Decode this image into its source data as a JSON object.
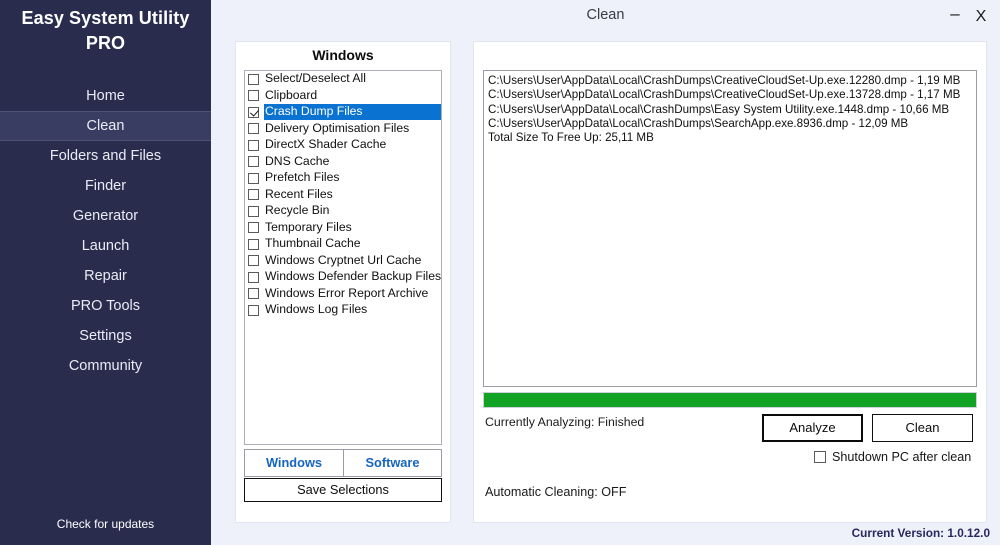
{
  "app": {
    "title": "Easy System Utility PRO",
    "version_label": "Current Version: 1.0.12.0",
    "check_updates": "Check for updates"
  },
  "titlebar": {
    "window_title": "Clean",
    "minimize": "–",
    "close": "X"
  },
  "sidebar": {
    "items": [
      {
        "label": "Home",
        "active": false
      },
      {
        "label": "Clean",
        "active": true
      },
      {
        "label": "Folders and Files",
        "active": false
      },
      {
        "label": "Finder",
        "active": false
      },
      {
        "label": "Generator",
        "active": false
      },
      {
        "label": "Launch",
        "active": false
      },
      {
        "label": "Repair",
        "active": false
      },
      {
        "label": "PRO Tools",
        "active": false
      },
      {
        "label": "Settings",
        "active": false
      },
      {
        "label": "Community",
        "active": false
      }
    ]
  },
  "left_panel": {
    "header": "Windows",
    "checkboxes": [
      {
        "label": "Select/Deselect All",
        "checked": false,
        "selected": false
      },
      {
        "label": "Clipboard",
        "checked": false,
        "selected": false
      },
      {
        "label": "Crash Dump Files",
        "checked": true,
        "selected": true
      },
      {
        "label": "Delivery Optimisation Files",
        "checked": false,
        "selected": false
      },
      {
        "label": "DirectX Shader Cache",
        "checked": false,
        "selected": false
      },
      {
        "label": "DNS Cache",
        "checked": false,
        "selected": false
      },
      {
        "label": "Prefetch Files",
        "checked": false,
        "selected": false
      },
      {
        "label": "Recent Files",
        "checked": false,
        "selected": false
      },
      {
        "label": "Recycle Bin",
        "checked": false,
        "selected": false
      },
      {
        "label": "Temporary Files",
        "checked": false,
        "selected": false
      },
      {
        "label": "Thumbnail Cache",
        "checked": false,
        "selected": false
      },
      {
        "label": "Windows Cryptnet Url Cache",
        "checked": false,
        "selected": false
      },
      {
        "label": "Windows Defender Backup Files",
        "checked": false,
        "selected": false
      },
      {
        "label": "Windows Error Report Archive",
        "checked": false,
        "selected": false
      },
      {
        "label": "Windows Log Files",
        "checked": false,
        "selected": false
      }
    ],
    "tabs": [
      {
        "label": "Windows",
        "active": true
      },
      {
        "label": "Software",
        "active": false
      }
    ],
    "save_selections": "Save Selections"
  },
  "right_panel": {
    "log_lines": [
      "C:\\Users\\User\\AppData\\Local\\CrashDumps\\CreativeCloudSet-Up.exe.12280.dmp - 1,19 MB",
      "C:\\Users\\User\\AppData\\Local\\CrashDumps\\CreativeCloudSet-Up.exe.13728.dmp - 1,17 MB",
      "C:\\Users\\User\\AppData\\Local\\CrashDumps\\Easy System Utility.exe.1448.dmp - 10,66 MB",
      "C:\\Users\\User\\AppData\\Local\\CrashDumps\\SearchApp.exe.8936.dmp - 12,09 MB",
      "Total Size To Free Up: 25,11 MB"
    ],
    "progress_percent": 100,
    "progress_color": "#12a224",
    "status_analyzing": "Currently Analyzing: Finished",
    "status_autoclean": "Automatic Cleaning: OFF",
    "analyze_button": "Analyze",
    "clean_button": "Clean",
    "shutdown_checkbox": {
      "label": "Shutdown PC after clean",
      "checked": false
    }
  }
}
